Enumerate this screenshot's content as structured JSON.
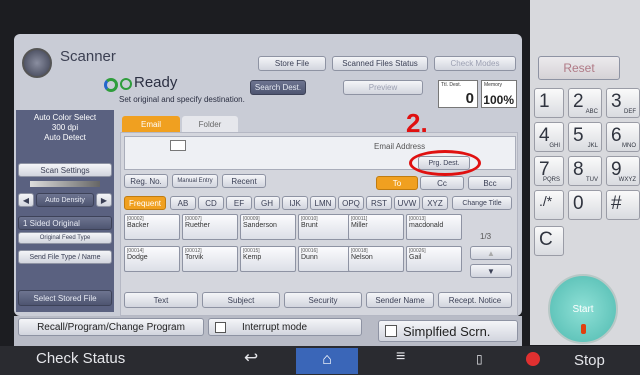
{
  "header": {
    "app_title": "Scanner",
    "status": "Ready",
    "instruction": "Set original and specify destination.",
    "store_file": "Store File",
    "scanned_status": "Scanned Files Status",
    "check_modes": "Check Modes",
    "search_dest": "Search Dest.",
    "preview": "Preview",
    "tot_dest_label": "Ttl. Dest.",
    "tot_dest_value": "0",
    "memory_label": "Memory",
    "memory_value": "100%"
  },
  "left_panel": {
    "color_mode": "Auto Color Select",
    "resolution": "300 dpi",
    "detect": "Auto Detect",
    "scan_settings": "Scan Settings",
    "density_label": "Auto Density",
    "sided": "1 Sided Original",
    "feed_type": "Original Feed Type",
    "send_file_type": "Send File Type / Name",
    "select_stored": "Select Stored File"
  },
  "tabs": {
    "email": "Email",
    "folder": "Folder"
  },
  "email_area": {
    "email_address": "Email Address",
    "prg_dest": "Prg. Dest."
  },
  "mode_buttons": {
    "reg_no": "Reg. No.",
    "manual_entry": "Manual Entry",
    "recent": "Recent",
    "to": "To",
    "cc": "Cc",
    "bcc": "Bcc"
  },
  "index_tabs": [
    "Frequent",
    "AB",
    "CD",
    "EF",
    "GH",
    "IJK",
    "LMN",
    "OPQ",
    "RST",
    "UVW",
    "XYZ",
    "Change Title"
  ],
  "destinations": [
    {
      "code": "[00002]",
      "name": "Backer"
    },
    {
      "code": "[00007]",
      "name": "Ruether"
    },
    {
      "code": "[00009]",
      "name": "Sanderson"
    },
    {
      "code": "[00010]",
      "name": "Brunt"
    },
    {
      "code": "[00011]",
      "name": "Miller"
    },
    {
      "code": "[00013]",
      "name": "macdonald"
    },
    {
      "code": "[00014]",
      "name": "Dodge"
    },
    {
      "code": "[00012]",
      "name": "Torvik"
    },
    {
      "code": "[00015]",
      "name": "Kemp"
    },
    {
      "code": "[00016]",
      "name": "Dunn"
    },
    {
      "code": "[00018]",
      "name": "Nelson"
    },
    {
      "code": "[00026]",
      "name": "Gail"
    }
  ],
  "page_indicator": "1/3",
  "bottom_tabs": [
    "Text",
    "Subject",
    "Security",
    "Sender Name",
    "Recept. Notice"
  ],
  "annotation": "2.",
  "lower_bar": {
    "recall": "Recall/Program/Change Program",
    "interrupt": "Interrupt mode",
    "simplified": "Simplfied Scrn."
  },
  "keypad": {
    "reset": "Reset",
    "start": "Start",
    "keys": [
      {
        "main": "1",
        "sub": ""
      },
      {
        "main": "2",
        "sub": "ABC"
      },
      {
        "main": "3",
        "sub": "DEF"
      },
      {
        "main": "4",
        "sub": "GHI"
      },
      {
        "main": "5",
        "sub": "JKL"
      },
      {
        "main": "6",
        "sub": "MNO"
      },
      {
        "main": "7",
        "sub": "PQRS"
      },
      {
        "main": "8",
        "sub": "TUV"
      },
      {
        "main": "9",
        "sub": "WXYZ"
      },
      {
        "main": "./*",
        "sub": ""
      },
      {
        "main": "0",
        "sub": ""
      },
      {
        "main": "#",
        "sub": ""
      }
    ],
    "clear": "C"
  },
  "taskbar": {
    "check_status": "Check Status",
    "stop": "Stop"
  },
  "colors": {
    "accent_orange": "#f0a020",
    "annotation_red": "#e01010",
    "panel": "#c9ccd6"
  }
}
